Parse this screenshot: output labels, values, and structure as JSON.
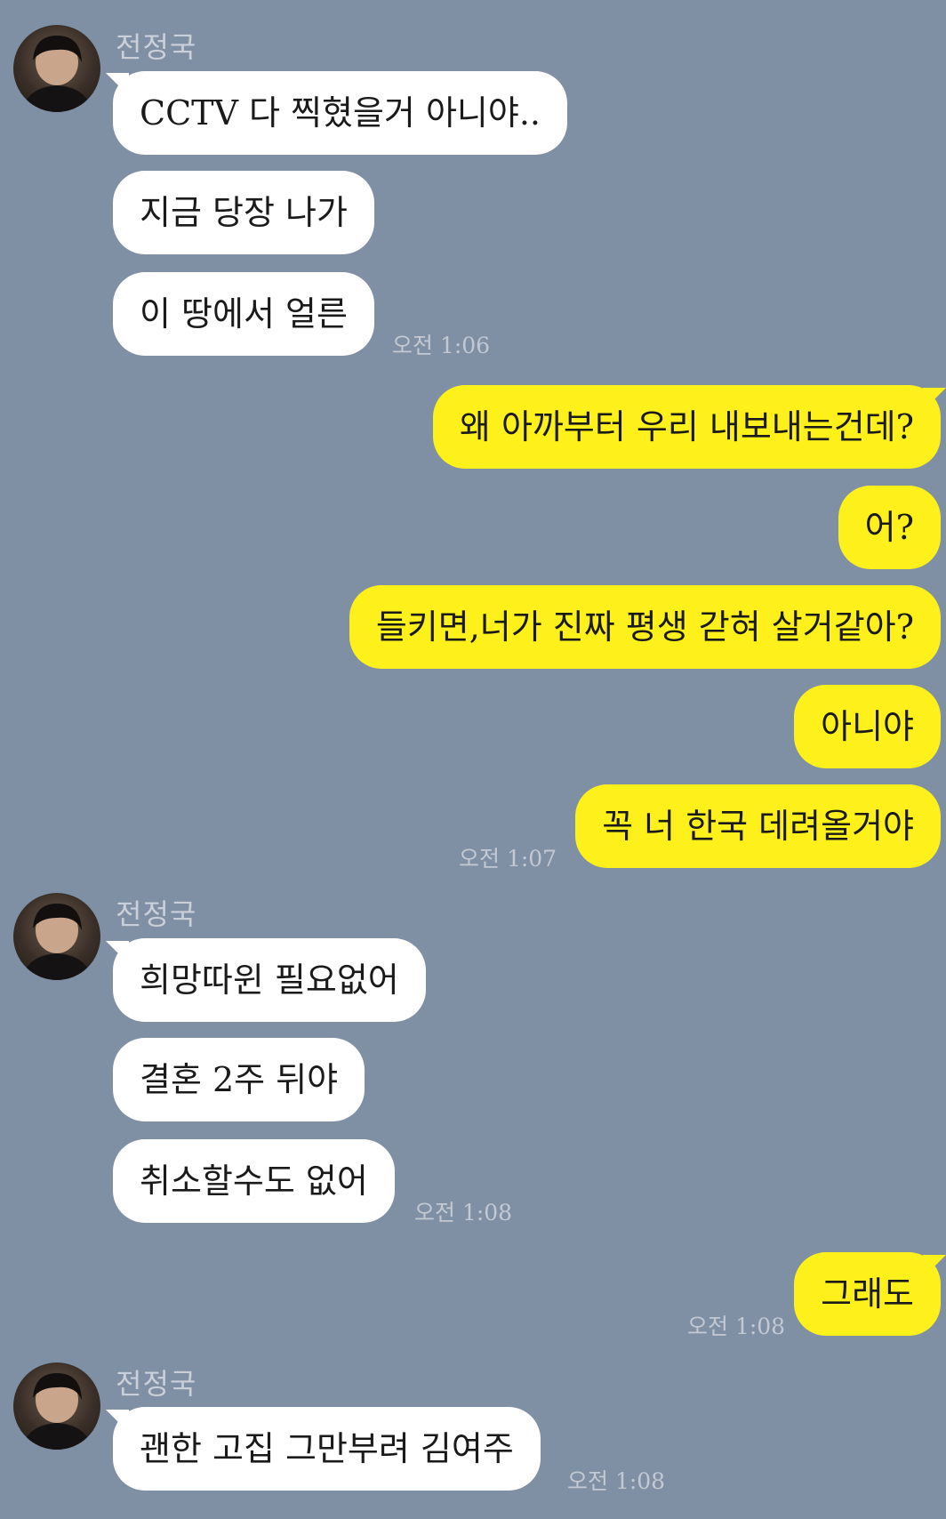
{
  "contact": {
    "name": "전정국",
    "avatar_icon": "avatar-photo-icon"
  },
  "colors": {
    "background": "#8090a4",
    "incoming_bubble": "#ffffff",
    "outgoing_bubble": "#fef01b"
  },
  "messages": [
    {
      "from": "contact",
      "text": "CCTV 다 찍혔을거 아니야.."
    },
    {
      "from": "contact",
      "text": "지금 당장 나가"
    },
    {
      "from": "contact",
      "text": "이 땅에서 얼른",
      "time": "오전 1:06"
    },
    {
      "from": "me",
      "text": "왜 아까부터 우리 내보내는건데?"
    },
    {
      "from": "me",
      "text": "어?"
    },
    {
      "from": "me",
      "text": "들키면,너가 진짜 평생 갇혀 살거같아?"
    },
    {
      "from": "me",
      "text": "아니야"
    },
    {
      "from": "me",
      "text": "꼭 너 한국 데려올거야",
      "time": "오전 1:07"
    },
    {
      "from": "contact",
      "text": "희망따윈 필요없어"
    },
    {
      "from": "contact",
      "text": "결혼 2주 뒤야"
    },
    {
      "from": "contact",
      "text": "취소할수도 없어",
      "time": "오전 1:08"
    },
    {
      "from": "me",
      "text": "그래도",
      "time": "오전 1:08"
    },
    {
      "from": "contact",
      "text": "괜한 고집 그만부려 김여주",
      "time": "오전 1:08"
    }
  ]
}
